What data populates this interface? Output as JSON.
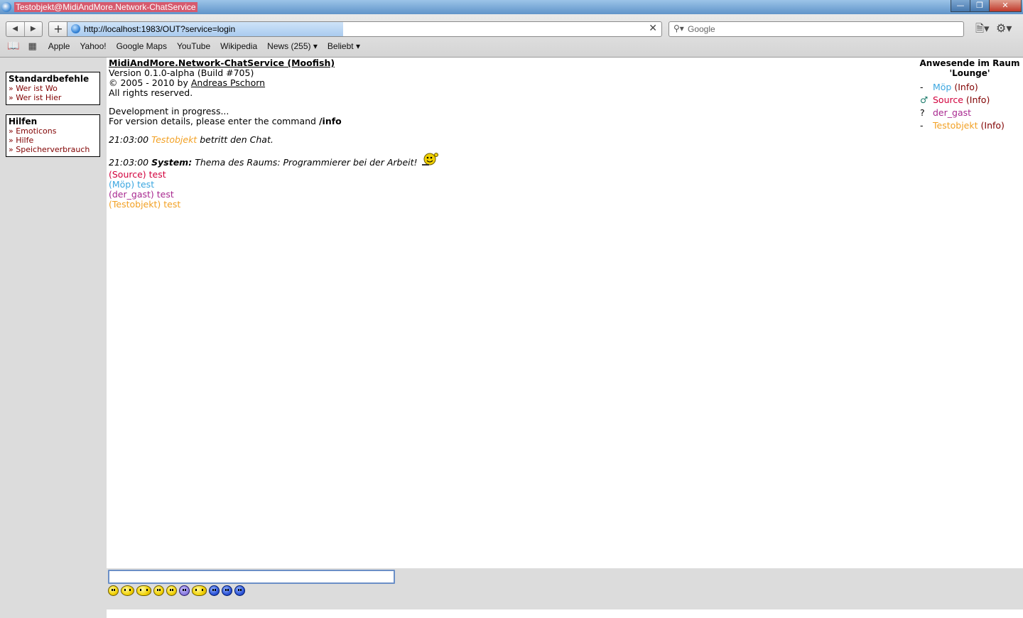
{
  "window": {
    "title": "Testobjekt@MidiAndMore.Network-ChatService",
    "buttons": [
      "minimize",
      "maximize",
      "close"
    ]
  },
  "browser": {
    "url": "http://localhost:1983/OUT?service=login",
    "search_placeholder": "Google",
    "bookmarks": [
      "Apple",
      "Yahoo!",
      "Google Maps",
      "YouTube",
      "Wikipedia",
      "News (255)",
      "Beliebt"
    ],
    "icons": {
      "back": "left-arrow-icon",
      "forward": "right-arrow-icon",
      "add": "plus-icon",
      "clear": "close-icon",
      "search": "magnifier-icon",
      "page": "page-icon",
      "settings": "gear-icon",
      "book": "book-icon",
      "grid": "grid-icon"
    }
  },
  "left": {
    "box1": {
      "title": "Standardbefehle",
      "links": [
        "» Wer ist Wo",
        "» Wer ist Hier"
      ]
    },
    "box2": {
      "title": "Hilfen",
      "links": [
        "» Emoticons",
        "» Hilfe",
        "» Speicherverbrauch"
      ]
    }
  },
  "main": {
    "title": "MidiAndMore.Network-ChatService (Moofish)",
    "version": "Version 0.1.0-alpha (Build #705)",
    "copyright_prefix": "© 2005 - 2010 by",
    "author": "Andreas Pschorn",
    "rights": "All rights reserved.",
    "dev": "Development in progress...",
    "info_prefix": "For version details, please enter the command",
    "info_cmd": "/info",
    "messages": {
      "join_time": "21:03:00",
      "join_user": "Testobjekt",
      "join_text": "betritt den Chat.",
      "system_time": "21:03:00",
      "system_label": "System:",
      "system_text": "Thema des Raums: Programmierer bei der Arbeit!",
      "lines": [
        {
          "text": "(Source) test",
          "color": "#d2003c"
        },
        {
          "text": "(Möp) test",
          "color": "#3aa6e0"
        },
        {
          "text": "(der_gast) test",
          "color": "#a8288f"
        },
        {
          "text": "(Testobjekt) test",
          "color": "#f2a023"
        }
      ]
    }
  },
  "right": {
    "title": "Anwesende im Raum 'Lounge'",
    "users": [
      {
        "mark": "-",
        "name": "Möp",
        "info": "(Info)",
        "color": "#3aa6e0"
      },
      {
        "mark": "♂",
        "name": "Source",
        "info": "(Info)",
        "color": "#d2003c"
      },
      {
        "mark": "?",
        "name": "der_gast",
        "info": "",
        "color": "#a8288f"
      },
      {
        "mark": "-",
        "name": "Testobjekt",
        "info": "(Info)",
        "color": "#f2a023"
      }
    ]
  },
  "chat": {
    "input_value": "",
    "emoticons": [
      "smiley-icon",
      "tongue-icon",
      "grin-icon",
      "smile-icon",
      "happy-icon",
      "violet-icon",
      "wave-icon",
      "blue-icon",
      "blue-smile-icon",
      "blue-grin-icon"
    ]
  }
}
